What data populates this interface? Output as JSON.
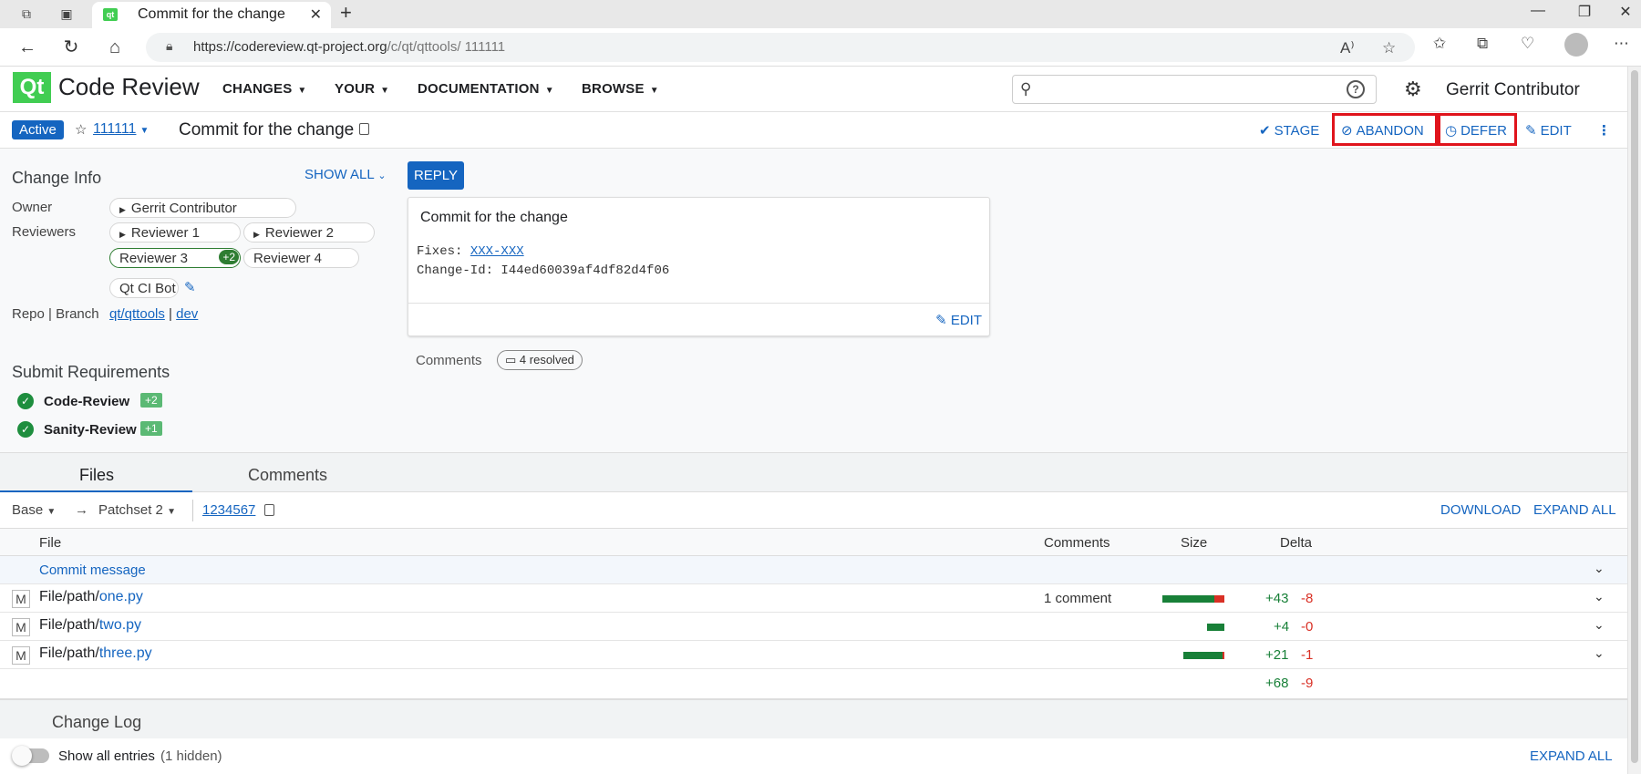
{
  "browser": {
    "tab_title": "Commit for the change",
    "favicon_text": "qt",
    "url_base": "https://codereview.qt-project.org",
    "url_path": "/c/qt/qttools/ 111111",
    "new_tab": "+",
    "close_tab": "✕"
  },
  "header": {
    "logo": "Qt",
    "title": "Code Review",
    "menus": [
      "CHANGES",
      "YOUR",
      "DOCUMENTATION",
      "BROWSE"
    ],
    "search_placeholder": "",
    "user": "Gerrit Contributor"
  },
  "change": {
    "status": "Active",
    "number": "111111",
    "subject": "Commit for the change",
    "actions": {
      "stage": "STAGE",
      "abandon": "ABANDON",
      "defer": "DEFER",
      "edit": "EDIT"
    }
  },
  "change_info": {
    "title": "Change Info",
    "show_all": "SHOW ALL",
    "owner_label": "Owner",
    "owner": "Gerrit Contributor",
    "reviewers_label": "Reviewers",
    "reviewers": [
      "Reviewer 1",
      "Reviewer 2",
      "Reviewer 3",
      "Reviewer 4",
      "Qt CI Bot"
    ],
    "reviewer3_vote": "+2",
    "repo_label": "Repo | Branch",
    "repo": "qt/qttools",
    "sep": "|",
    "branch": "dev"
  },
  "submit_requirements": {
    "title": "Submit Requirements",
    "items": [
      {
        "name": "Code-Review",
        "vote": "+2"
      },
      {
        "name": "Sanity-Review",
        "vote": "+1"
      }
    ]
  },
  "commit": {
    "reply": "REPLY",
    "subject": "Commit for the change",
    "fixes_label": "Fixes:",
    "fixes_link": "XXX-XXX",
    "change_id": "Change-Id: I44ed60039af4df82d4f06",
    "edit": "EDIT",
    "comments_label": "Comments",
    "resolved": "4 resolved"
  },
  "files_tabs": {
    "files": "Files",
    "comments": "Comments"
  },
  "patch": {
    "base": "Base",
    "arrow": "→",
    "patchset": "Patchset 2",
    "commit": "1234567",
    "download": "DOWNLOAD",
    "expand_all": "EXPAND ALL"
  },
  "table": {
    "headers": {
      "file": "File",
      "comments": "Comments",
      "size": "Size",
      "delta": "Delta"
    },
    "commit_message": "Commit message",
    "rows": [
      {
        "status": "M",
        "dir": "File/path/",
        "name": "one.py",
        "comments": "1 comment",
        "plus": "+43",
        "minus": "-8",
        "added": 43,
        "removed": 8
      },
      {
        "status": "M",
        "dir": "File/path/",
        "name": "two.py",
        "comments": "",
        "plus": "+4",
        "minus": "-0",
        "added": 4,
        "removed": 0
      },
      {
        "status": "M",
        "dir": "File/path/",
        "name": "three.py",
        "comments": "",
        "plus": "+21",
        "minus": "-1",
        "added": 21,
        "removed": 1
      }
    ],
    "total_plus": "+68",
    "total_minus": "-9"
  },
  "changelog": {
    "title": "Change Log",
    "show_all": "Show all entries",
    "hidden": "(1 hidden)",
    "expand_all": "EXPAND ALL"
  },
  "colors": {
    "accent": "#1565c0",
    "qt_green": "#41cd52",
    "added": "#188038",
    "removed": "#d93025",
    "highlight": "#e0141c"
  }
}
